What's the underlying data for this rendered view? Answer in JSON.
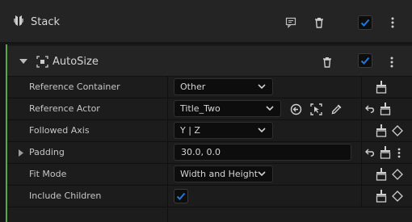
{
  "header": {
    "title": "Stack",
    "enabled": true
  },
  "module": {
    "title": "AutoSize",
    "enabled": true
  },
  "rows": [
    {
      "label": "Reference Container",
      "type": "select",
      "value": "Other"
    },
    {
      "label": "Reference Actor",
      "type": "select",
      "value": "Title_Two"
    },
    {
      "label": "Followed Axis",
      "type": "select",
      "value": "Y | Z"
    },
    {
      "label": "Padding",
      "type": "text",
      "value": "30.0, 0.0"
    },
    {
      "label": "Fit Mode",
      "type": "select",
      "value": "Width and Height"
    },
    {
      "label": "Include Children",
      "type": "checkbox",
      "value": true
    }
  ],
  "colors": {
    "accent_green": "#5aa843",
    "checkbox_blue": "#1e7ae0"
  }
}
